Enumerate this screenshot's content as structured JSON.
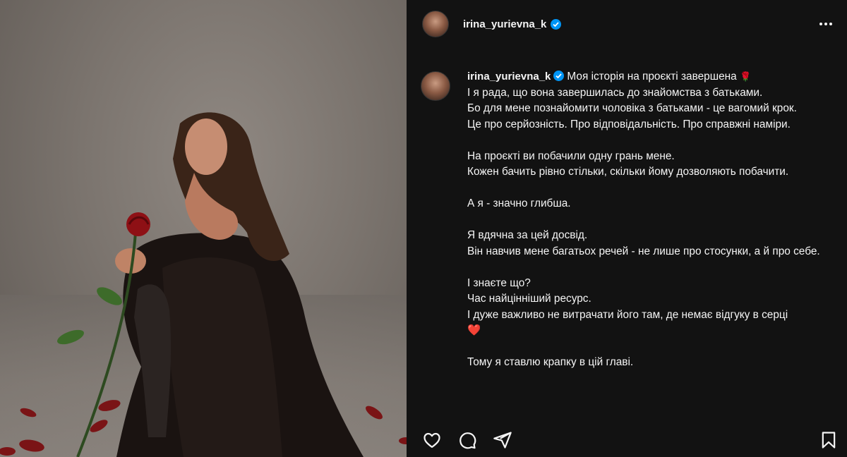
{
  "post": {
    "username": "irina_yurievna_k",
    "verified": true,
    "menu_icon": "more-horizontal-icon"
  },
  "caption": {
    "username": "irina_yurievna_k",
    "lines": [
      "Моя історія на проєкті завершена",
      "І я рада, що вона завершилась до знайомства з батьками.",
      "Бо для мене познайомити чоловіка з батьками - це вагомий крок.",
      "Це про серйозність. Про відповідальність. Про справжні наміри.",
      "",
      "На проєкті ви побачили одну грань мене.",
      "Кожен бачить рівно стільки, скільки йому дозволяють побачити.",
      "",
      "А я - значно глибша.",
      "",
      "Я вдячна за цей досвід.",
      "Він навчив мене багатьох речей - не лише про стосунки, а й про себе.",
      "",
      "І знаєте що?",
      "Час найцінніший ресурс.",
      "І дуже важливо не витрачати його там, де немає відгуку в серці",
      "",
      "Тому я ставлю крапку в цій главі."
    ],
    "emoji_rose": "🌹",
    "emoji_heart": "❤️"
  },
  "actions": {
    "like_icon": "heart-icon",
    "comment_icon": "comment-icon",
    "share_icon": "send-icon",
    "save_icon": "bookmark-icon"
  },
  "colors": {
    "panel_bg": "#121212",
    "text": "#f5f5f5",
    "verified": "#0095f6",
    "accent_red": "#e0245e"
  }
}
